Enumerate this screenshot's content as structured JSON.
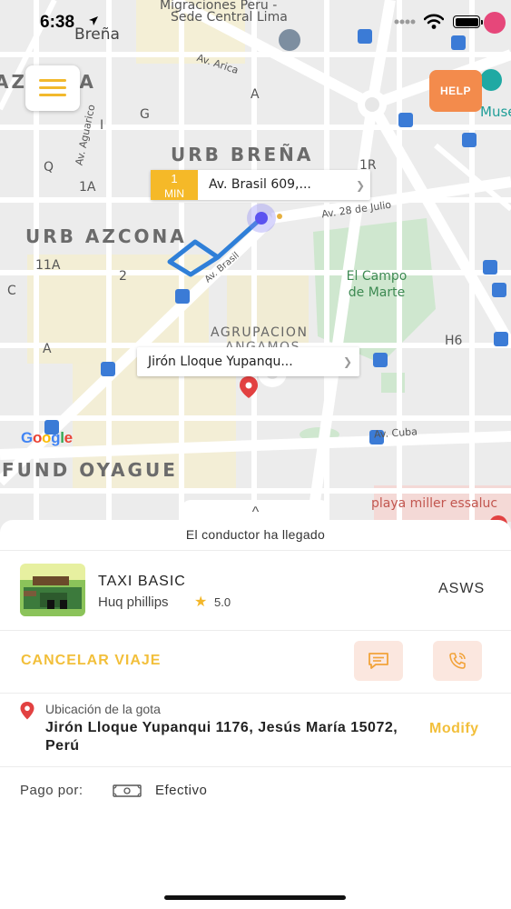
{
  "status_bar": {
    "time": "6:38"
  },
  "map": {
    "top_labels": {
      "poi": "Migraciones Peru -",
      "poi2": "Sede Central Lima",
      "district": "Breña"
    },
    "neighborhoods": [
      "URB BREÑA",
      "URB AZCONA",
      "AGRUPACION",
      "ANGAMOS",
      "FUND OYAGUE",
      "AZCONA"
    ],
    "streets": [
      "Av. Arica",
      "Av. Aguarico",
      "Av. 28 de Julio",
      "Av. Brasil",
      "Av. Cuba"
    ],
    "blocks": [
      "G",
      "I",
      "Q",
      "1A",
      "11A",
      "C",
      "2",
      "A",
      "1R",
      "H6",
      "A"
    ],
    "park": "El Campo de Marte",
    "poi_right": "Muse",
    "poi_bottom": "playa miller essaluc",
    "google": "Google"
  },
  "help_label": "HELP",
  "eta": {
    "value": "1",
    "unit": "MIN",
    "address": "Av. Brasil 609,..."
  },
  "destination_tag": "Jirón Lloque Yupanqu...",
  "sheet": {
    "handle": "^",
    "status_text": "El conductor ha llegado",
    "driver": {
      "car_type": "TAXI BASIC",
      "name": "Huq phillips",
      "rating": "5.0",
      "plate": "ASWS"
    },
    "cancel_label": "CANCELAR VIAJE",
    "dropoff": {
      "label": "Ubicación de la gota",
      "address": "Jirón Lloque Yupanqui 1176, Jesús María 15072, Perú",
      "modify_label": "Modify"
    },
    "payment": {
      "label": "Pago por:",
      "method": "Efectivo"
    }
  },
  "colors": {
    "accent": "#f2bf3a",
    "help": "#f38b4c",
    "route": "#2f7fd8",
    "action_bg": "#fbe7df"
  }
}
